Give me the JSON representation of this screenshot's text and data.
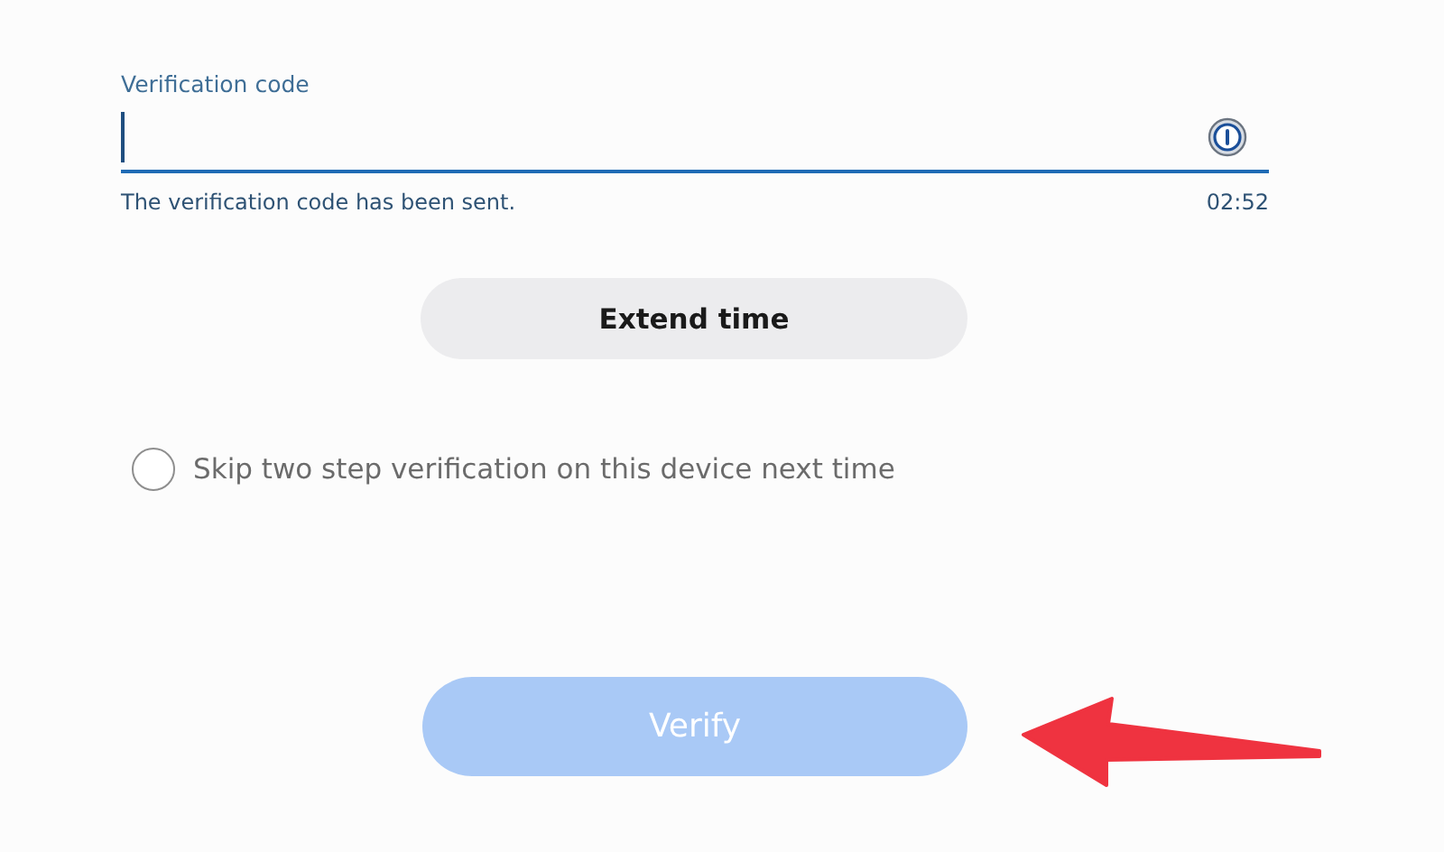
{
  "code_field": {
    "label": "Verification code",
    "focused": true
  },
  "helper_text": "The verification code has been sent.",
  "timer": "02:52",
  "extend_button": {
    "label": "Extend time"
  },
  "skip_option": {
    "label": "Skip two step verification on this device next time",
    "checked": false
  },
  "verify_button": {
    "label": "Verify",
    "disabled": true
  }
}
